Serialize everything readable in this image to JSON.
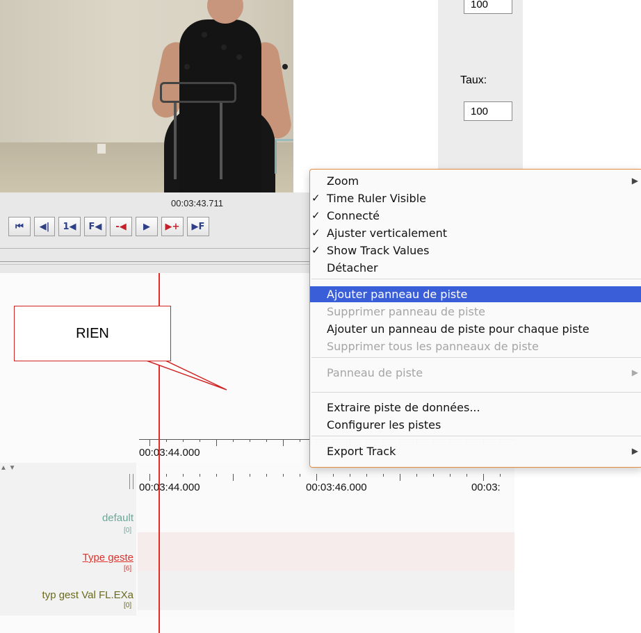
{
  "video": {
    "timecode": "00:03:43.711"
  },
  "side_panel": {
    "top_value": "100",
    "rate_label": "Taux:",
    "rate_value": "100"
  },
  "player_buttons": [
    {
      "name": "go-to-start",
      "glyph": "⏮"
    },
    {
      "name": "previous-scroll",
      "glyph": "◀|"
    },
    {
      "name": "previous-step",
      "glyph": "1◀"
    },
    {
      "name": "previous-frame",
      "glyph": "F◀"
    },
    {
      "name": "selection-begin",
      "glyph": "-◀"
    },
    {
      "name": "play",
      "glyph": "▶"
    },
    {
      "name": "selection-end",
      "glyph": "▶+"
    },
    {
      "name": "next-frame",
      "glyph": "▶F"
    }
  ],
  "callout": {
    "text": "RIEN"
  },
  "menu": {
    "items": [
      {
        "label": "Zoom",
        "checked": false,
        "disabled": false,
        "submenu": true
      },
      {
        "label": "Time Ruler Visible",
        "checked": true,
        "disabled": false,
        "submenu": false
      },
      {
        "label": "Connecté",
        "checked": true,
        "disabled": false,
        "submenu": false
      },
      {
        "label": "Ajuster verticalement",
        "checked": true,
        "disabled": false,
        "submenu": false
      },
      {
        "label": "Show Track Values",
        "checked": true,
        "disabled": false,
        "submenu": false
      },
      {
        "label": "Détacher",
        "checked": false,
        "disabled": false,
        "submenu": false
      },
      {
        "label": "Ajouter panneau de piste",
        "checked": false,
        "disabled": false,
        "highlighted": true,
        "submenu": false
      },
      {
        "label": "Supprimer panneau de piste",
        "checked": false,
        "disabled": true,
        "submenu": false
      },
      {
        "label": "Ajouter un panneau de piste pour chaque piste",
        "checked": false,
        "disabled": false,
        "submenu": false
      },
      {
        "label": "Supprimer tous les panneaux de piste",
        "checked": false,
        "disabled": true,
        "submenu": false
      },
      {
        "label": "Panneau de piste",
        "checked": false,
        "disabled": true,
        "submenu": true
      },
      {
        "label": "Extraire piste de données...",
        "checked": false,
        "disabled": false,
        "submenu": false
      },
      {
        "label": "Configurer les pistes",
        "checked": false,
        "disabled": false,
        "submenu": false
      },
      {
        "label": "Export Track",
        "checked": false,
        "disabled": false,
        "submenu": true
      }
    ]
  },
  "timeline": {
    "ruler_top_label": "00:03:44.000",
    "ruler_bottom_labels": [
      "00:03:44.000",
      "00:03:46.000",
      "00:03:"
    ]
  },
  "tiers": [
    {
      "name": "default",
      "count": "[0]",
      "color": "#6aa89a"
    },
    {
      "name": "Type geste",
      "count": "[6]",
      "color": "#e0302b"
    },
    {
      "name": "typ gest Val FL.EXa",
      "count": "[0]",
      "color": "#6b6a1c"
    }
  ],
  "colors": {
    "crosshair": "#e42b25",
    "menu_highlight": "#3a5dd8",
    "menu_border": "#e38a3e",
    "callout_border": "#d12222"
  }
}
